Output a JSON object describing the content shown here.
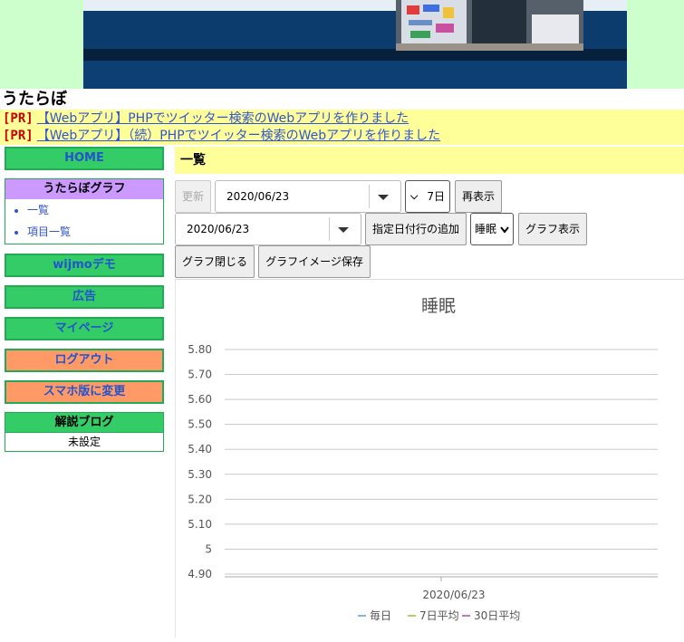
{
  "site": {
    "title": "うたらぼ"
  },
  "pr": [
    {
      "tag": "[PR]",
      "text": "【Webアプリ】PHPでツイッター検索のWebアプリを作りました"
    },
    {
      "tag": "[PR]",
      "text": "【Webアプリ】（続）PHPでツイッター検索のWebアプリを作りました"
    }
  ],
  "sidebar": {
    "home": "HOME",
    "graph_box": {
      "title": "うたらぼグラフ",
      "items": [
        "一覧",
        "項目一覧"
      ]
    },
    "wijmo": "wijmoデモ",
    "ads": "広告",
    "mypage": "マイページ",
    "logout": "ログアウト",
    "mobile": "スマホ版に変更",
    "blog_box": {
      "title": "解説ブログ",
      "value": "未設定"
    }
  },
  "main": {
    "title": "一覧",
    "update_label": "更新",
    "date1": "2020/06/23",
    "days_value": "7日",
    "redisplay_label": "再表示",
    "date2": "2020/06/23",
    "add_row_label": "指定日付行の追加",
    "item_value": "睡眠",
    "show_graph_label": "グラフ表示",
    "close_graph_label": "グラフ閉じる",
    "save_image_label": "グラフイメージ保存"
  },
  "chart_data": {
    "type": "line",
    "title": "睡眠",
    "categories": [
      "2020/06/23"
    ],
    "series": [
      {
        "name": "毎日",
        "color": "#5b9bd5",
        "values": []
      },
      {
        "name": "7日平均",
        "color": "#a5b83a",
        "values": []
      },
      {
        "name": "30日平均",
        "color": "#9b4fbf",
        "values": []
      }
    ],
    "yticks": [
      "5.80",
      "5.70",
      "5.60",
      "5.50",
      "5.40",
      "5.30",
      "5.20",
      "5.10",
      "5",
      "4.90"
    ],
    "ylim": [
      4.9,
      5.8
    ],
    "grid": true,
    "legend": "bottom"
  }
}
